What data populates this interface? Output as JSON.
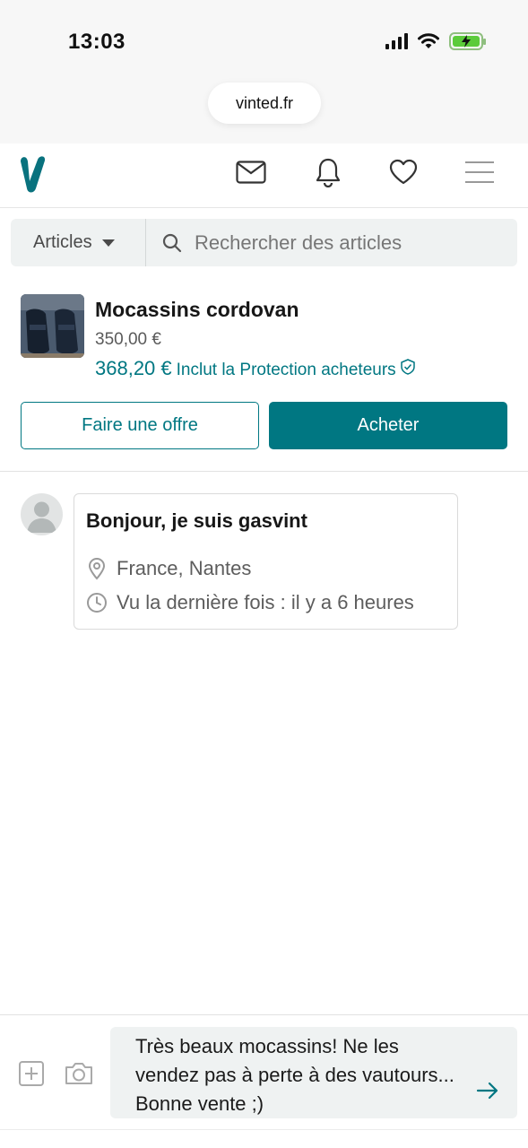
{
  "status_bar": {
    "time": "13:03"
  },
  "browser": {
    "url": "vinted.fr"
  },
  "header": {
    "logo": "V",
    "icons": [
      "mail-icon",
      "bell-icon",
      "heart-icon",
      "menu-icon"
    ]
  },
  "search": {
    "category_label": "Articles",
    "placeholder": "Rechercher des articles"
  },
  "item": {
    "title": "Mocassins cordovan",
    "price": "350,00 €",
    "total_price": "368,20 €",
    "protection_label": "Inclut la Protection acheteurs"
  },
  "actions": {
    "offer_label": "Faire une offre",
    "buy_label": "Acheter"
  },
  "profile": {
    "greeting": "Bonjour, je suis gasvint",
    "location": "France, Nantes",
    "last_seen": "Vu la dernière fois : il y a 6 heures"
  },
  "composer": {
    "message": "Très beaux mocassins! Ne les vendez pas à perte à des vautours... Bonne vente ;)"
  },
  "colors": {
    "brand": "#007782",
    "background": "#ffffff",
    "input_bg": "#eff2f2"
  }
}
